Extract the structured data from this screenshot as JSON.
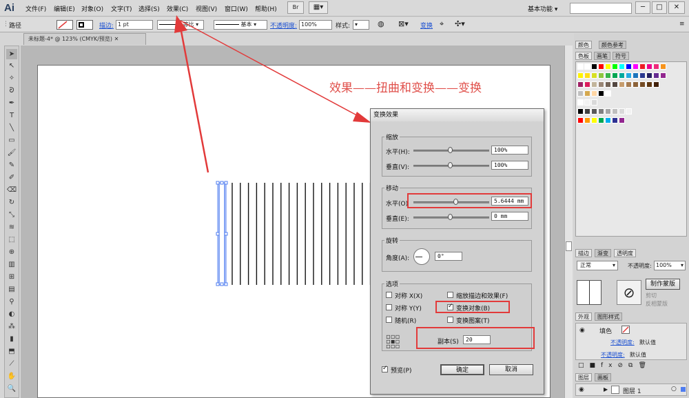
{
  "app": {
    "logo": "Ai",
    "workspace": "基本功能 ▾"
  },
  "menu": [
    "文件(F)",
    "编辑(E)",
    "对象(O)",
    "文字(T)",
    "选择(S)",
    "效果(C)",
    "视图(V)",
    "窗口(W)",
    "帮助(H)"
  ],
  "control_bar": {
    "path_label": "路径",
    "stroke_label": "描边:",
    "stroke_value": "1 pt",
    "profile_label": "等比",
    "brush_label": "基本",
    "opacity_label": "不透明度:",
    "opacity_value": "100%",
    "style_label": "样式:",
    "transform_label": "变换"
  },
  "document": {
    "tab": "未标题-4* @ 123% (CMYK/预览)"
  },
  "annotation": "效果——扭曲和变换——变换",
  "dialog": {
    "title": "变换效果",
    "scale": {
      "label": "缩放",
      "h_label": "水平(H):",
      "h_value": "100%",
      "v_label": "垂直(V):",
      "v_value": "100%"
    },
    "move": {
      "label": "移动",
      "h_label": "水平(O)",
      "h_value": "5.6444 mm",
      "v_label": "垂直(E):",
      "v_value": "0 mm"
    },
    "rotate": {
      "label": "旋转",
      "angle_label": "角度(A):",
      "angle_value": "0°"
    },
    "options": {
      "label": "选项",
      "reflect_x": "对称 X(X)",
      "reflect_y": "对称 Y(Y)",
      "random": "随机(R)",
      "scale_strokes": "缩放描边和效果(F)",
      "transform_objects": "变换对象(B)",
      "transform_patterns": "变换图案(T)",
      "copies_label": "副本(S)",
      "copies_value": "20"
    },
    "preview": "预览(P)",
    "ok": "确定",
    "cancel": "取消"
  },
  "panels": {
    "color_tabs": [
      "颜色",
      "颜色参考"
    ],
    "swatch_tabs": [
      "色板",
      "画笔",
      "符号"
    ],
    "stroke_tabs": [
      "描边",
      "渐变",
      "透明度"
    ],
    "blend_mode": "正常",
    "opacity_label": "不透明度:",
    "opacity_value": "100%",
    "make_mask": "制作蒙版",
    "clip": "剪切",
    "invert": "反相蒙版",
    "appearance_tabs": [
      "外观",
      "图形样式"
    ],
    "fill_label": "填色",
    "appearance_opacity": "不透明度:",
    "appearance_default": "默认值",
    "layer_tabs": [
      "图层",
      "画板"
    ],
    "layer_name": "图层 1"
  },
  "colors": {
    "accent_red": "#e23a3a",
    "link_blue": "#1a4fd1"
  }
}
